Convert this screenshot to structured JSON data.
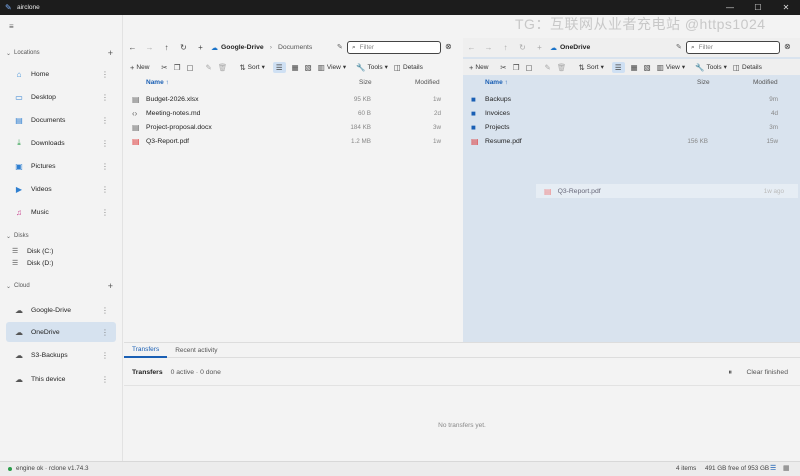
{
  "window": {
    "title": "airclone",
    "minimize": "—",
    "maximize": "☐",
    "close": "✕"
  },
  "watermark": "TG：互联网从业者充电站 @https1024",
  "sidebar": {
    "collapse_icon": "≡",
    "locations_label": "Locations",
    "locations": [
      {
        "label": "Home",
        "icon": "home-icon"
      },
      {
        "label": "Desktop",
        "icon": "desktop-icon"
      },
      {
        "label": "Documents",
        "icon": "documents-icon"
      },
      {
        "label": "Downloads",
        "icon": "download-icon"
      },
      {
        "label": "Pictures",
        "icon": "pictures-icon"
      },
      {
        "label": "Videos",
        "icon": "videos-icon"
      },
      {
        "label": "Music",
        "icon": "music-icon"
      }
    ],
    "disks_label": "Disks",
    "disks": [
      {
        "label": "Disk (C:)"
      },
      {
        "label": "Disk (D:)"
      }
    ],
    "cloud_label": "Cloud",
    "clouds": [
      {
        "label": "Google-Drive"
      },
      {
        "label": "OneDrive",
        "active": true
      },
      {
        "label": "S3-Backups"
      },
      {
        "label": "This device"
      }
    ]
  },
  "left_pane": {
    "root": "Google-Drive",
    "sub": "Documents",
    "filter_placeholder": "Filter",
    "col_name": "Name ↑",
    "col_size": "Size",
    "col_modified": "Modified",
    "files": [
      {
        "name": "Budget-2026.xlsx",
        "size": "95 KB",
        "modified": "1w",
        "type": "doc"
      },
      {
        "name": "Meeting-notes.md",
        "size": "60 B",
        "modified": "2d",
        "type": "code"
      },
      {
        "name": "Project-proposal.docx",
        "size": "184 KB",
        "modified": "3w",
        "type": "doc"
      },
      {
        "name": "Q3-Report.pdf",
        "size": "1.2 MB",
        "modified": "1w",
        "type": "pdf"
      }
    ]
  },
  "right_pane": {
    "root": "OneDrive",
    "filter_placeholder": "Filter",
    "col_name": "Name ↑",
    "col_size": "Size",
    "col_modified": "Modified",
    "files": [
      {
        "name": "Backups",
        "size": "",
        "modified": "9m",
        "type": "folder"
      },
      {
        "name": "Invoices",
        "size": "",
        "modified": "4d",
        "type": "folder"
      },
      {
        "name": "Projects",
        "size": "",
        "modified": "3m",
        "type": "folder"
      },
      {
        "name": "Resume.pdf",
        "size": "156 KB",
        "modified": "15w",
        "type": "pdf"
      }
    ],
    "drag_ghost": {
      "name": "Q3-Report.pdf",
      "modified": "1w ago"
    }
  },
  "toolbar": {
    "new": "New",
    "sort": "Sort",
    "view": "View",
    "tools": "Tools",
    "details": "Details"
  },
  "bottom": {
    "tab_transfers": "Transfers",
    "tab_recent": "Recent activity",
    "transfers_title": "Transfers",
    "transfers_status": "0 active · 0 done",
    "clear_finished": "Clear finished",
    "empty": "No transfers yet."
  },
  "statusbar": {
    "engine": "engine ok · rclone v1.74.3",
    "items": "4 items",
    "free": "491 GB free of 953 GB"
  }
}
